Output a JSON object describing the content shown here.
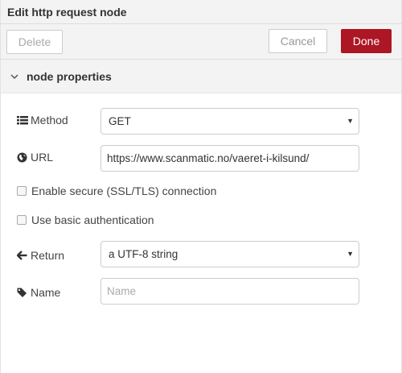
{
  "header": {
    "title": "Edit http request node"
  },
  "toolbar": {
    "delete_label": "Delete",
    "cancel_label": "Cancel",
    "done_label": "Done"
  },
  "section": {
    "title": "node properties",
    "expanded": true
  },
  "form": {
    "method": {
      "label": "Method",
      "icon": "list-icon",
      "value": "GET"
    },
    "url": {
      "label": "URL",
      "icon": "globe-icon",
      "value": "https://www.scanmatic.no/vaeret-i-kilsund/"
    },
    "tls": {
      "label": "Enable secure (SSL/TLS) connection",
      "checked": false
    },
    "auth": {
      "label": "Use basic authentication",
      "checked": false
    },
    "return": {
      "label": "Return",
      "icon": "arrow-left-icon",
      "value": "a UTF-8 string"
    },
    "name": {
      "label": "Name",
      "icon": "tag-icon",
      "value": "",
      "placeholder": "Name"
    }
  },
  "colors": {
    "accent": "#ad1625",
    "header_bg": "#f3f3f3"
  }
}
